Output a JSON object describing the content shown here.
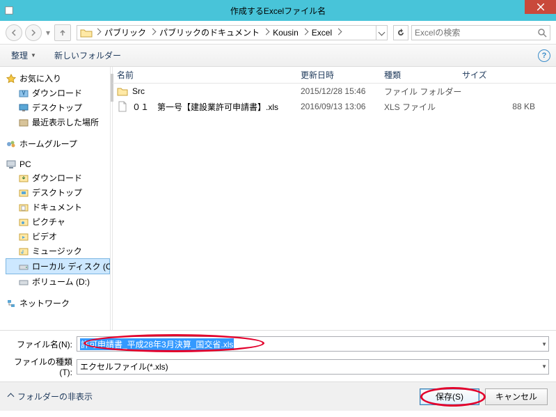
{
  "window": {
    "title": "作成するExcelファイル名"
  },
  "nav": {
    "breadcrumb": [
      "パブリック",
      "パブリックのドキュメント",
      "Kousin",
      "Excel"
    ],
    "search_placeholder": "Excelの検索"
  },
  "toolbar": {
    "organize": "整理",
    "new_folder": "新しいフォルダー"
  },
  "columns": {
    "name": "名前",
    "date": "更新日時",
    "type": "種類",
    "size": "サイズ"
  },
  "sidebar": {
    "favorites": {
      "label": "お気に入り",
      "items": [
        "ダウンロード",
        "デスクトップ",
        "最近表示した場所"
      ]
    },
    "homegroup": {
      "label": "ホームグループ"
    },
    "pc": {
      "label": "PC",
      "items": [
        "ダウンロード",
        "デスクトップ",
        "ドキュメント",
        "ピクチャ",
        "ビデオ",
        "ミュージック",
        "ローカル ディスク (C",
        "ボリューム (D:)"
      ]
    },
    "network": {
      "label": "ネットワーク"
    }
  },
  "files": [
    {
      "name": "Src",
      "date": "2015/12/28 15:46",
      "type": "ファイル フォルダー",
      "size": "",
      "icon": "folder"
    },
    {
      "name": "０１　第一号【建設業許可申請書】.xls",
      "date": "2016/09/13 13:06",
      "type": "XLS ファイル",
      "size": "88 KB",
      "icon": "file"
    }
  ],
  "fields": {
    "filename_label": "ファイル名(N):",
    "filename_value": "許可申請書_平成28年3月決算_国交省.xls",
    "filetype_label": "ファイルの種類(T):",
    "filetype_value": "エクセルファイル(*.xls)"
  },
  "footer": {
    "hide_folders": "フォルダーの非表示",
    "save": "保存(S)",
    "cancel": "キャンセル"
  }
}
